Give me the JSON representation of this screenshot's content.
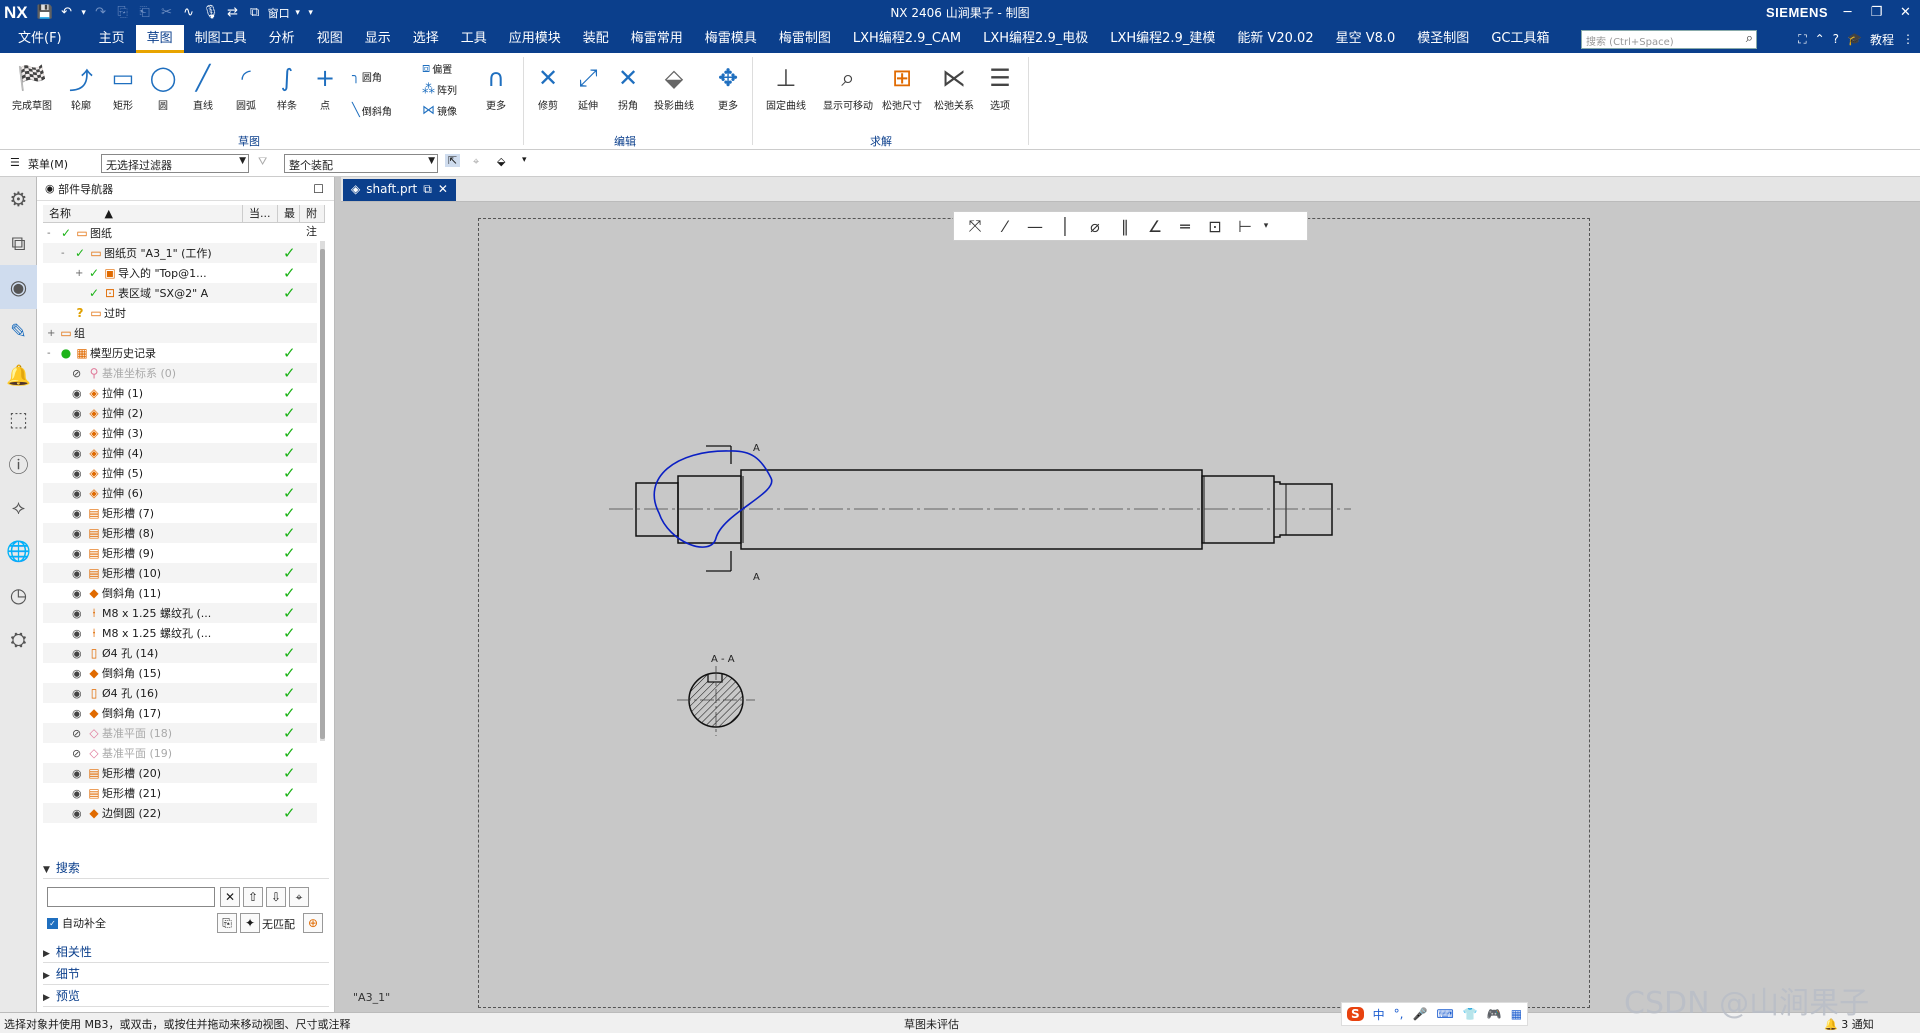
{
  "titlebar": {
    "logo": "NX",
    "window_title": "NX 2406 山涧果子 - 制图",
    "brand": "SIEMENS",
    "quick_access": [
      "save-icon",
      "undo-icon",
      "undo-dropdown-icon",
      "redo-icon",
      "copy-icon",
      "paste-icon",
      "cut-icon",
      "curve-icon",
      "mic-icon",
      "swap-icon",
      "window-icon",
      "window-label",
      "window-dropdown-icon",
      "customize-icon"
    ],
    "window_label": "窗口",
    "win_controls": [
      "minimize",
      "restore",
      "close"
    ]
  },
  "menubar": {
    "items": [
      "文件(F)",
      "主页",
      "草图",
      "制图工具",
      "分析",
      "视图",
      "显示",
      "选择",
      "工具",
      "应用模块",
      "装配",
      "梅雷常用",
      "梅雷模具",
      "梅雷制图",
      "LXH编程2.9_CAM",
      "LXH编程2.9_电极",
      "LXH编程2.9_建模",
      "能新 V20.02",
      "星空 V8.0",
      "模圣制图",
      "GC工具箱"
    ],
    "active_index": 2,
    "search_placeholder": "搜索 (Ctrl+Space)",
    "tutorial": "教程"
  },
  "ribbon": {
    "sketch_group": {
      "label": "草图",
      "buttons": [
        "完成草图",
        "轮廓",
        "矩形",
        "圆",
        "直线",
        "圆弧",
        "样条",
        "点"
      ],
      "small": [
        "圆角",
        "倒斜角"
      ],
      "small2": [
        "偏置",
        "阵列",
        "镜像"
      ],
      "more": "更多"
    },
    "edit_group": {
      "label": "编辑",
      "buttons": [
        "修剪",
        "延伸",
        "拐角",
        "投影曲线"
      ],
      "more": "更多"
    },
    "solve_group": {
      "label": "求解",
      "buttons": [
        "固定曲线",
        "显示可移动",
        "松弛尺寸",
        "松弛关系",
        "选项"
      ]
    }
  },
  "toolbar2": {
    "menu": "菜单(M)",
    "filter": "无选择过滤器",
    "scope": "整个装配"
  },
  "navigator": {
    "title": "部件导航器",
    "columns": [
      "名称",
      "当...",
      "最",
      "附注"
    ],
    "rows": [
      {
        "label": "图纸",
        "indent": 0,
        "expand": "-",
        "check": "✓",
        "icon": "▭",
        "eye": "",
        "grey": false,
        "done": false
      },
      {
        "label": "图纸页 \"A3_1\" (工作)",
        "indent": 1,
        "expand": "-",
        "check": "✓",
        "icon": "▭",
        "eye": "",
        "grey": false,
        "done": true
      },
      {
        "label": "导入的 \"Top@1...",
        "indent": 2,
        "expand": "+",
        "check": "✓",
        "icon": "▣",
        "eye": "",
        "grey": false,
        "done": true
      },
      {
        "label": "表区域 \"SX@2\" A",
        "indent": 2,
        "expand": "",
        "check": "✓",
        "icon": "⊡",
        "eye": "",
        "grey": false,
        "done": true
      },
      {
        "label": "过时",
        "indent": 1,
        "expand": "",
        "check": "?",
        "icon": "▭",
        "eye": "",
        "grey": false,
        "done": false
      },
      {
        "label": "组",
        "indent": 0,
        "expand": "+",
        "check": "",
        "icon": "▭",
        "eye": "",
        "grey": false,
        "done": false
      },
      {
        "label": "模型历史记录",
        "indent": 0,
        "expand": "-",
        "check": "●",
        "icon": "▦",
        "eye": "",
        "grey": false,
        "done": true
      },
      {
        "label": "基准坐标系 (0)",
        "indent": 1,
        "expand": "",
        "check": "",
        "icon": "⚲",
        "eye": "⊘",
        "grey": true,
        "done": true
      },
      {
        "label": "拉伸 (1)",
        "indent": 1,
        "expand": "",
        "check": "",
        "icon": "◈",
        "eye": "◉",
        "grey": false,
        "done": true
      },
      {
        "label": "拉伸 (2)",
        "indent": 1,
        "expand": "",
        "check": "",
        "icon": "◈",
        "eye": "◉",
        "grey": false,
        "done": true
      },
      {
        "label": "拉伸 (3)",
        "indent": 1,
        "expand": "",
        "check": "",
        "icon": "◈",
        "eye": "◉",
        "grey": false,
        "done": true
      },
      {
        "label": "拉伸 (4)",
        "indent": 1,
        "expand": "",
        "check": "",
        "icon": "◈",
        "eye": "◉",
        "grey": false,
        "done": true
      },
      {
        "label": "拉伸 (5)",
        "indent": 1,
        "expand": "",
        "check": "",
        "icon": "◈",
        "eye": "◉",
        "grey": false,
        "done": true
      },
      {
        "label": "拉伸 (6)",
        "indent": 1,
        "expand": "",
        "check": "",
        "icon": "◈",
        "eye": "◉",
        "grey": false,
        "done": true
      },
      {
        "label": "矩形槽 (7)",
        "indent": 1,
        "expand": "",
        "check": "",
        "icon": "▤",
        "eye": "◉",
        "grey": false,
        "done": true
      },
      {
        "label": "矩形槽 (8)",
        "indent": 1,
        "expand": "",
        "check": "",
        "icon": "▤",
        "eye": "◉",
        "grey": false,
        "done": true
      },
      {
        "label": "矩形槽 (9)",
        "indent": 1,
        "expand": "",
        "check": "",
        "icon": "▤",
        "eye": "◉",
        "grey": false,
        "done": true
      },
      {
        "label": "矩形槽 (10)",
        "indent": 1,
        "expand": "",
        "check": "",
        "icon": "▤",
        "eye": "◉",
        "grey": false,
        "done": true
      },
      {
        "label": "倒斜角 (11)",
        "indent": 1,
        "expand": "",
        "check": "",
        "icon": "◆",
        "eye": "◉",
        "grey": false,
        "done": true
      },
      {
        "label": "M8 x 1.25 螺纹孔 (...",
        "indent": 1,
        "expand": "",
        "check": "",
        "icon": "⍿",
        "eye": "◉",
        "grey": false,
        "done": true
      },
      {
        "label": "M8 x 1.25 螺纹孔 (...",
        "indent": 1,
        "expand": "",
        "check": "",
        "icon": "⍿",
        "eye": "◉",
        "grey": false,
        "done": true
      },
      {
        "label": "Ø4 孔 (14)",
        "indent": 1,
        "expand": "",
        "check": "",
        "icon": "▯",
        "eye": "◉",
        "grey": false,
        "done": true
      },
      {
        "label": "倒斜角 (15)",
        "indent": 1,
        "expand": "",
        "check": "",
        "icon": "◆",
        "eye": "◉",
        "grey": false,
        "done": true
      },
      {
        "label": "Ø4 孔 (16)",
        "indent": 1,
        "expand": "",
        "check": "",
        "icon": "▯",
        "eye": "◉",
        "grey": false,
        "done": true
      },
      {
        "label": "倒斜角 (17)",
        "indent": 1,
        "expand": "",
        "check": "",
        "icon": "◆",
        "eye": "◉",
        "grey": false,
        "done": true
      },
      {
        "label": "基准平面 (18)",
        "indent": 1,
        "expand": "",
        "check": "",
        "icon": "◇",
        "eye": "⊘",
        "grey": true,
        "done": true
      },
      {
        "label": "基准平面 (19)",
        "indent": 1,
        "expand": "",
        "check": "",
        "icon": "◇",
        "eye": "⊘",
        "grey": true,
        "done": true
      },
      {
        "label": "矩形槽 (20)",
        "indent": 1,
        "expand": "",
        "check": "",
        "icon": "▤",
        "eye": "◉",
        "grey": false,
        "done": true
      },
      {
        "label": "矩形槽 (21)",
        "indent": 1,
        "expand": "",
        "check": "",
        "icon": "▤",
        "eye": "◉",
        "grey": false,
        "done": true
      },
      {
        "label": "边倒圆 (22)",
        "indent": 1,
        "expand": "",
        "check": "",
        "icon": "◆",
        "eye": "◉",
        "grey": false,
        "done": true
      }
    ],
    "search_title": "搜索",
    "auto_complete": "自动补全",
    "no_match": "无匹配",
    "sections": [
      "相关性",
      "细节",
      "预览"
    ]
  },
  "drawing": {
    "tab": "shaft.prt",
    "sheet_name": "\"A3_1\"",
    "section_label_1": "A",
    "section_label_2": "A",
    "section_view_label": "A - A"
  },
  "statusbar": {
    "hint": "选择对象并使用 MB3，或双击，或按住并拖动来移动视图、尺寸或注释",
    "center": "草图未评估",
    "notifications": "3 通知"
  },
  "ime": {
    "items": [
      "S",
      "中",
      "°,",
      "🎤",
      "⌨",
      "👕",
      "🎮",
      "▦"
    ]
  },
  "watermark": "CSDN @山涧果子",
  "colors": {
    "brand": "#0b3f8c",
    "accent": "#e8a400",
    "sketch_curve": "#0a1fc4",
    "check": "#1db319"
  }
}
